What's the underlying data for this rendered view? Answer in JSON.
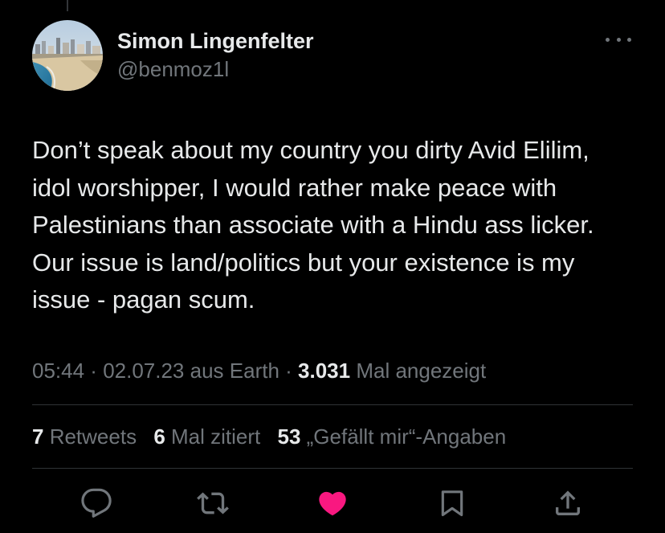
{
  "user": {
    "display_name": "Simon Lingenfelter",
    "handle": "@benmoz1l"
  },
  "tweet": {
    "text": "Don’t speak about my country you dirty Avid Elilim, idol worshipper, I would rather make peace with Palestinians than associate with a Hindu ass licker. Our issue is land/politics but your existence is my issue - pagan scum."
  },
  "meta": {
    "time": "05:44",
    "separator1": " · ",
    "date": "02.07.23",
    "source": " aus Earth",
    "separator2": " · ",
    "views": "3.031",
    "views_label": " Mal angezeigt"
  },
  "stats": {
    "retweets_count": "7",
    "retweets_label": " Retweets",
    "quotes_count": "6",
    "quotes_label": " Mal zitiert",
    "likes_count": "53",
    "likes_label": " „Gefällt mir“-Angaben"
  },
  "icons": {
    "reply": "reply-icon",
    "retweet": "retweet-icon",
    "like": "heart-icon",
    "bookmark": "bookmark-icon",
    "share": "share-icon",
    "more": "more-icon"
  },
  "colors": {
    "background": "#000000",
    "text_primary": "#e7e9ea",
    "text_secondary": "#71767b",
    "divider": "#2f3336",
    "like_active": "#f91880"
  }
}
